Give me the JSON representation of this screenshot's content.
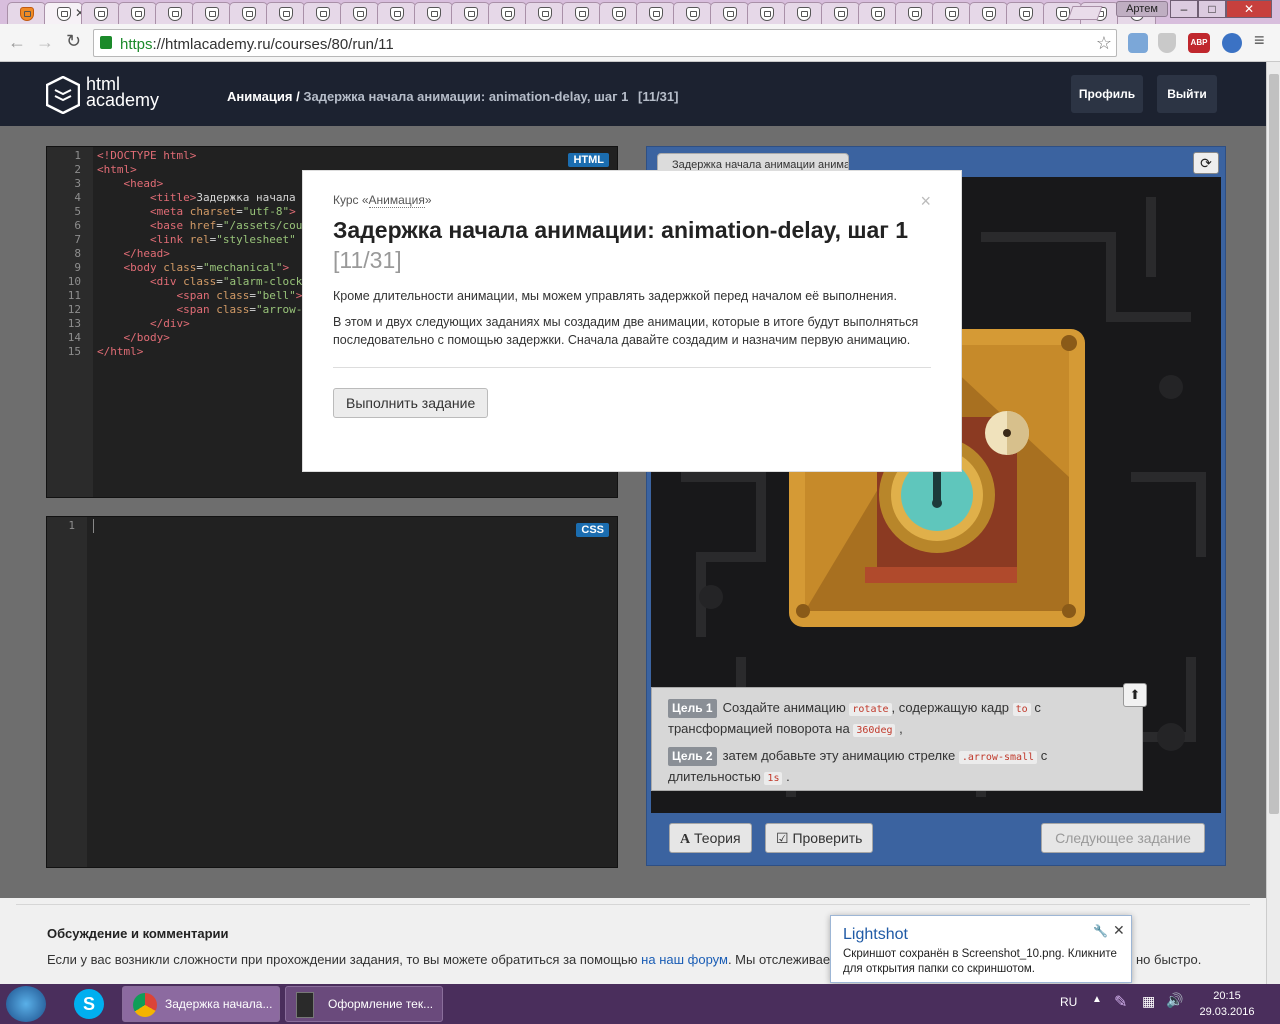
{
  "browser": {
    "tab_count": 31,
    "user_label": "Артем",
    "url_scheme": "https",
    "url_rest": "://htmlacademy.ru/courses/80/run/11",
    "window_buttons": [
      "–",
      "□",
      "✕"
    ]
  },
  "site": {
    "logo_line1": "html",
    "logo_line2": "academy",
    "crumb_course": "Анимация /",
    "crumb_lesson": "Задержка начала анимации: animation-delay, шаг 1",
    "crumb_step": "[11/31]",
    "profile_label": "Профиль",
    "logout_label": "Выйти"
  },
  "html_editor": {
    "badge": "HTML",
    "line_numbers": "1\n2\n3\n4\n5\n6\n7\n8\n9\n10\n11\n12\n13\n14\n15"
  },
  "css_editor": {
    "badge": "CSS",
    "line_numbers": "1"
  },
  "preview": {
    "tab_title": "Задержка начала анимации анима",
    "goal1_label": "Цель 1",
    "goal1_text_a": "Создайте анимацию",
    "goal1_code_a": "rotate",
    "goal1_text_b": ", содержащую кадр",
    "goal1_code_b": "to",
    "goal1_text_c": "с трансформацией поворота на",
    "goal1_code_c": "360deg",
    "goal1_text_d": ",",
    "goal2_label": "Цель 2",
    "goal2_text_a": "затем добавьте эту анимацию стрелке",
    "goal2_code_a": ".arrow-small",
    "goal2_text_b": "с длительностью",
    "goal2_code_b": "1s",
    "goal2_text_c": ".",
    "theory_label": "Теория",
    "check_label": "Проверить",
    "next_label": "Следующее задание"
  },
  "modal": {
    "course_prefix": "Курс «",
    "course_name": "Анимация",
    "course_suffix": "»",
    "title": "Задержка начала анимации: animation-delay, шаг 1",
    "step": "[11/31]",
    "para1": "Кроме длительности анимации, мы можем управлять задержкой перед началом её выполнения.",
    "para2": "В этом и двух следующих заданиях мы создадим две анимации, которые в итоге будут выполняться последовательно с помощью задержки. Сначала давайте создадим и назначим первую анимацию.",
    "run_label": "Выполнить задание",
    "close": "×"
  },
  "discussion": {
    "title": "Обсуждение и комментарии",
    "text_a": "Если у вас возникли сложности при прохождении задания, то вы можете обратиться за помощью",
    "link": "на наш форум",
    "text_b": ". Мы отслеживаем",
    "text_c": "но быстро."
  },
  "toast": {
    "title": "Lightshot",
    "body_1": "Скриншот сохранён в Screenshot_10.png. Кликните",
    "body_2": "для открытия папки со скриншотом."
  },
  "taskbar": {
    "task1": "Задержка начала...",
    "task2": "Оформление тек...",
    "lang": "RU",
    "time": "20:15",
    "date": "29.03.2016"
  }
}
